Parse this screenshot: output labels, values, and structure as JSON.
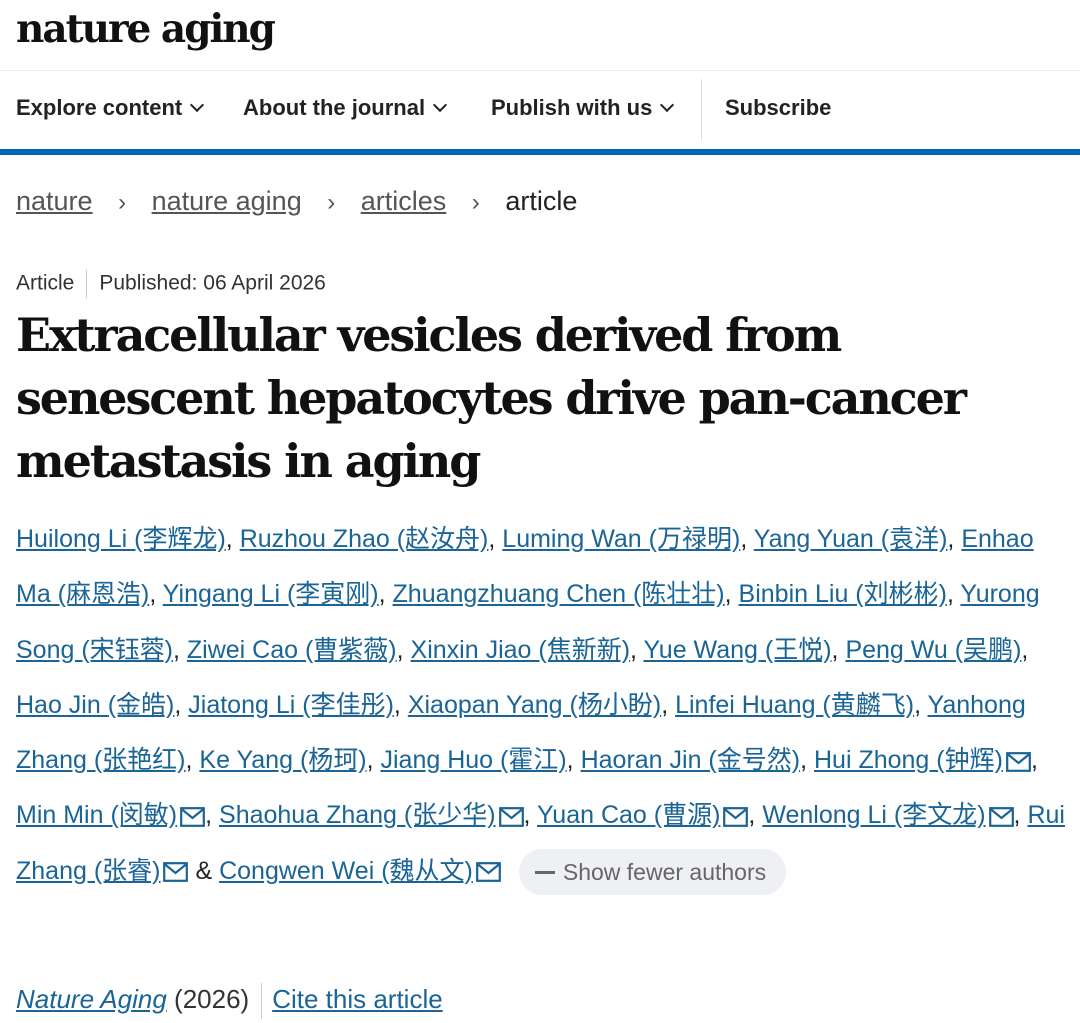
{
  "brand": {
    "logo_text": "nature aging"
  },
  "nav": {
    "items": [
      {
        "label": "Explore content",
        "has_dropdown": true
      },
      {
        "label": "About the journal",
        "has_dropdown": true
      },
      {
        "label": "Publish with us",
        "has_dropdown": true
      },
      {
        "label": "Subscribe",
        "has_dropdown": false
      }
    ],
    "accent_color": "#0069b4"
  },
  "breadcrumb": {
    "items": [
      "nature",
      "nature aging",
      "articles"
    ],
    "separator": "›",
    "current": "article"
  },
  "article": {
    "type": "Article",
    "published": "Published: 06 April 2026",
    "title": "Extracellular vesicles derived from senescent hepatocytes drive pan-cancer metastasis in aging",
    "authors": [
      {
        "name": "Huilong Li  (李辉龙)",
        "email": false
      },
      {
        "name": "Ruzhou Zhao  (赵汝舟)",
        "email": false
      },
      {
        "name": "Luming Wan  (万禄明)",
        "email": false
      },
      {
        "name": "Yang Yuan  (袁洋)",
        "email": false
      },
      {
        "name": "Enhao Ma  (麻恩浩)",
        "email": false
      },
      {
        "name": "Yingang Li  (李寅刚)",
        "email": false
      },
      {
        "name": "Zhuangzhuang Chen  (陈壮壮)",
        "email": false
      },
      {
        "name": "Binbin Liu  (刘彬彬)",
        "email": false
      },
      {
        "name": "Yurong Song  (宋钰蓉)",
        "email": false
      },
      {
        "name": "Ziwei Cao  (曹紫薇)",
        "email": false
      },
      {
        "name": "Xinxin Jiao  (焦新新)",
        "email": false
      },
      {
        "name": "Yue Wang  (王悦)",
        "email": false
      },
      {
        "name": "Peng Wu  (吴鹏)",
        "email": false
      },
      {
        "name": "Hao Jin  (金皓)",
        "email": false
      },
      {
        "name": "Jiatong Li  (李佳彤)",
        "email": false
      },
      {
        "name": "Xiaopan Yang  (杨小盼)",
        "email": false
      },
      {
        "name": "Linfei Huang  (黄麟飞)",
        "email": false
      },
      {
        "name": "Yanhong Zhang  (张艳红)",
        "email": false
      },
      {
        "name": "Ke Yang  (杨珂)",
        "email": false
      },
      {
        "name": "Jiang Huo  (霍江)",
        "email": false
      },
      {
        "name": "Haoran Jin  (金号然)",
        "email": false
      },
      {
        "name": "Hui Zhong  (钟辉)",
        "email": true
      },
      {
        "name": "Min Min  (闵敏)",
        "email": true
      },
      {
        "name": "Shaohua Zhang  (张少华)",
        "email": true
      },
      {
        "name": "Yuan Cao  (曹源)",
        "email": true
      },
      {
        "name": "Wenlong Li  (李文龙)",
        "email": true
      },
      {
        "name": "Rui Zhang  (张睿)",
        "email": true
      },
      {
        "name": "Congwen Wei  (魏从文)",
        "email": true
      }
    ],
    "and_symbol": "&",
    "show_fewer_label": "Show fewer authors",
    "journal": "Nature Aging",
    "year": "(2026)",
    "cite_label": "Cite this article"
  },
  "colors": {
    "link": "#1a6496",
    "accent": "#0069b4",
    "button_bg": "#eef0f3"
  }
}
